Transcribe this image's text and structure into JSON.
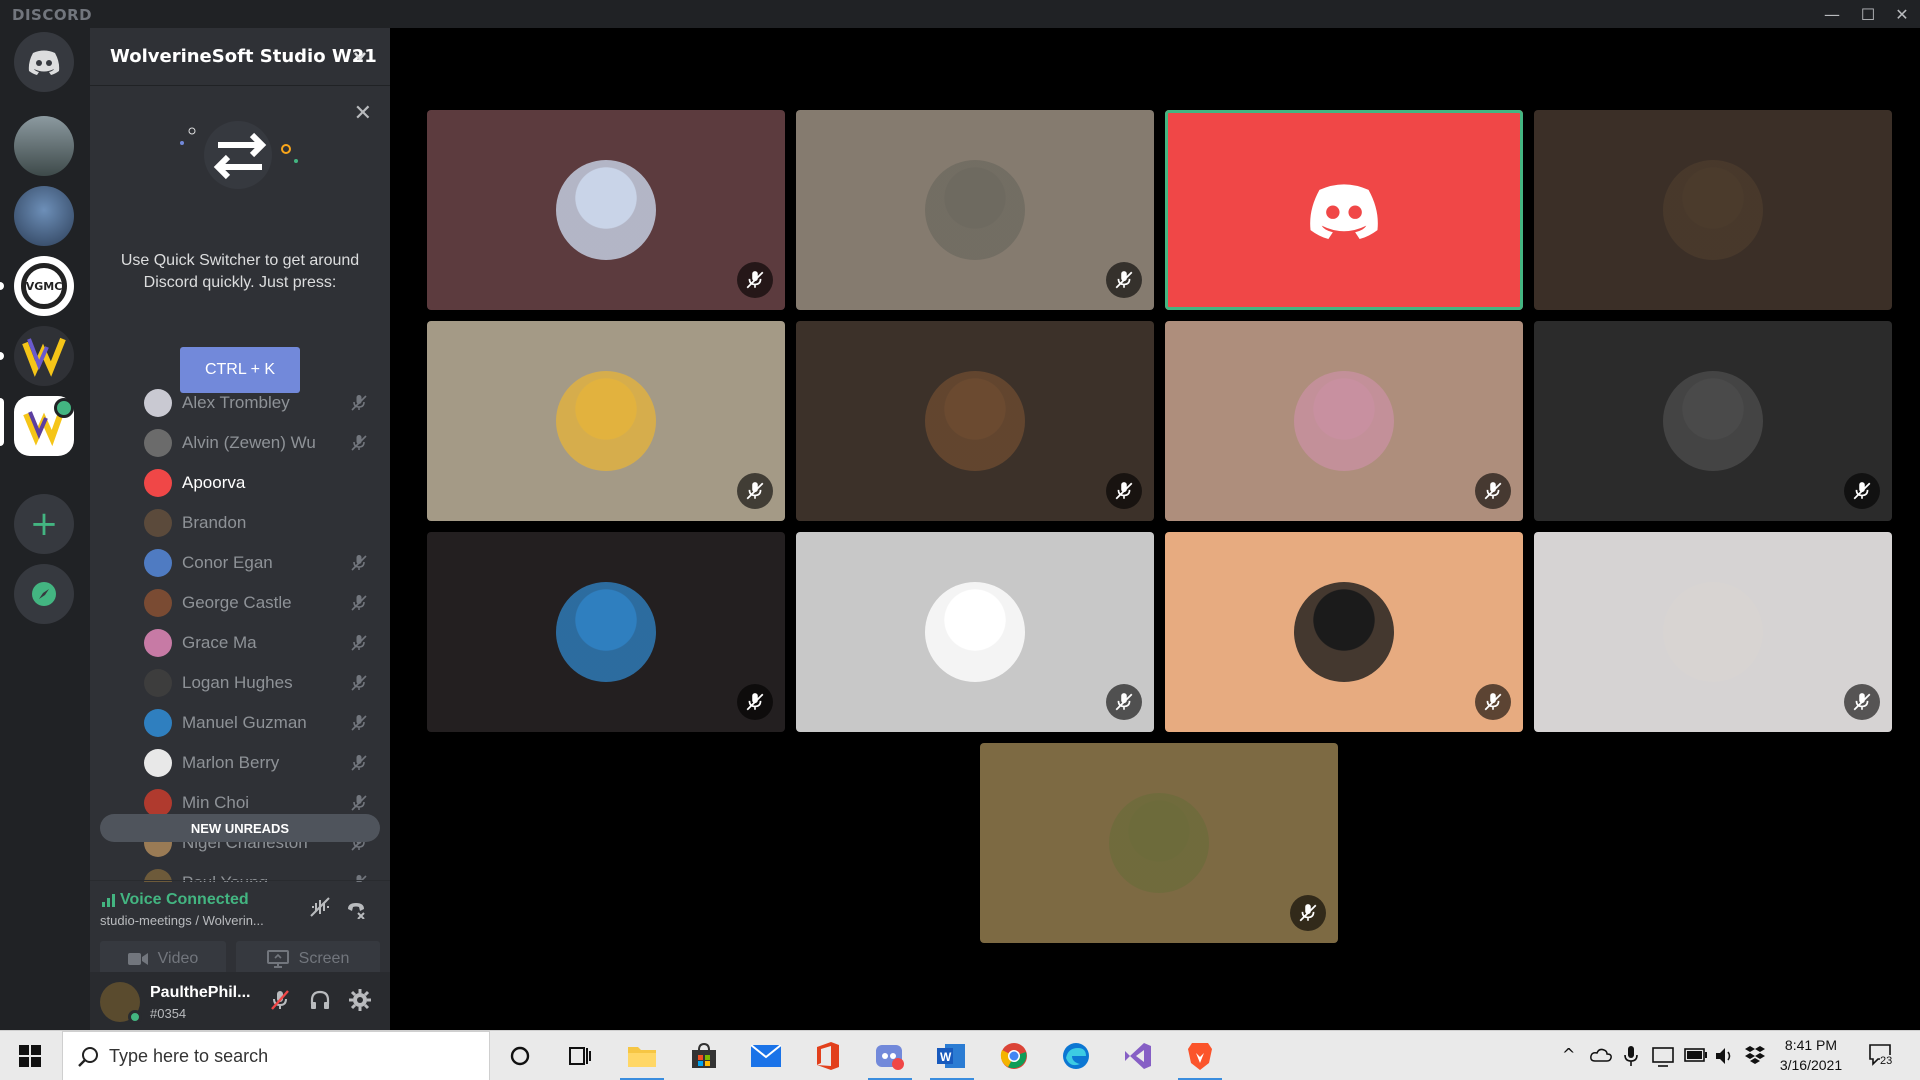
{
  "titlebar": {
    "brand": "DISCORD",
    "minimize": "—",
    "maximize": "☐",
    "close": "✕"
  },
  "server": {
    "name": "WolverineSoft Studio W21"
  },
  "quick_switcher": {
    "text_line1": "Use Quick Switcher to get around",
    "text_line2": "Discord quickly. Just press:",
    "shortcut": "CTRL + K",
    "close": "✕"
  },
  "members": [
    {
      "name": "Alex Trombley",
      "muted": true,
      "color": "#c9c9d2"
    },
    {
      "name": "Alvin (Zewen) Wu",
      "muted": true,
      "color": "#6b6b6b"
    },
    {
      "name": "Apoorva",
      "muted": false,
      "bright": true,
      "color": "#f04747"
    },
    {
      "name": "Brandon",
      "muted": false,
      "color": "#5b4a3b"
    },
    {
      "name": "Conor Egan",
      "muted": true,
      "color": "#4f7bc2"
    },
    {
      "name": "George Castle",
      "muted": true,
      "color": "#7a4b33"
    },
    {
      "name": "Grace Ma",
      "muted": true,
      "color": "#c77aa5"
    },
    {
      "name": "Logan Hughes",
      "muted": true,
      "color": "#3d3d3d"
    },
    {
      "name": "Manuel Guzman",
      "muted": true,
      "color": "#2f7fbf"
    },
    {
      "name": "Marlon Berry",
      "muted": true,
      "color": "#e8e8e8"
    },
    {
      "name": "Min Choi",
      "muted": true,
      "color": "#b03a2e"
    },
    {
      "name": "Nigel Charleston",
      "muted": true,
      "color": "#9a7b55"
    },
    {
      "name": "Paul Young",
      "muted": true,
      "color": "#6d5a3a"
    }
  ],
  "new_unreads": "NEW UNREADS",
  "voice": {
    "status": "Voice Connected",
    "channel": "studio-meetings / Wolverin...",
    "video_label": "Video",
    "screen_label": "Screen"
  },
  "user": {
    "name": "PaulthePhil...",
    "tag": "#0354"
  },
  "tiles": [
    {
      "bg": "#5c3b3e",
      "face": "#c9d4e8",
      "muted": true,
      "speaking": false,
      "discord": false
    },
    {
      "bg": "#857b6f",
      "face": "#6e6a60",
      "muted": true,
      "speaking": false,
      "discord": false
    },
    {
      "bg": "#f04747",
      "face": "",
      "muted": false,
      "speaking": true,
      "discord": true
    },
    {
      "bg": "#3b2f27",
      "face": "#4b3b2c",
      "muted": false,
      "speaking": false,
      "discord": false
    },
    {
      "bg": "#a49a86",
      "face": "#e2b23e",
      "muted": true,
      "speaking": false,
      "discord": false
    },
    {
      "bg": "#3c3129",
      "face": "#6b4a30",
      "muted": true,
      "speaking": false,
      "discord": false
    },
    {
      "bg": "#ae8e7c",
      "face": "#c890a0",
      "muted": true,
      "speaking": false,
      "discord": false
    },
    {
      "bg": "#2b2b2b",
      "face": "#4a4a4a",
      "muted": true,
      "speaking": false,
      "discord": false
    },
    {
      "bg": "#231f20",
      "face": "#2f7fbf",
      "muted": true,
      "speaking": false,
      "discord": false
    },
    {
      "bg": "#c8c8c8",
      "face": "#ffffff",
      "muted": true,
      "speaking": false,
      "discord": false
    },
    {
      "bg": "#e7ab80",
      "face": "#1b1b1b",
      "muted": true,
      "speaking": false,
      "discord": false
    },
    {
      "bg": "#d6d3d3",
      "face": "#d8d4d2",
      "muted": true,
      "speaking": false,
      "discord": false
    },
    {
      "bg": "#7d6a43",
      "face": "#6d6b3b",
      "muted": true,
      "speaking": false,
      "discord": false
    }
  ],
  "taskbar": {
    "search_placeholder": "Type here to search",
    "time": "8:41 PM",
    "date": "3/16/2021",
    "notifications": "23"
  },
  "colors": {
    "accent": "#7289da",
    "online": "#43b581",
    "danger": "#f04747"
  }
}
